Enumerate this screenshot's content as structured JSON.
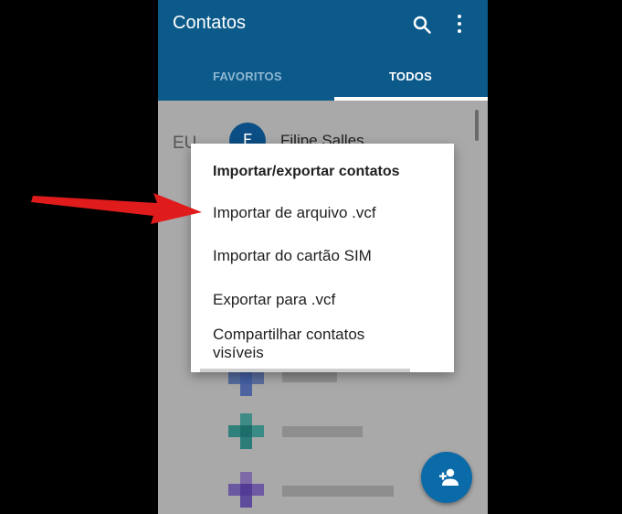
{
  "app": {
    "title": "Contatos"
  },
  "tabs": [
    {
      "label": "FAVORITOS",
      "selected": false
    },
    {
      "label": "TODOS",
      "selected": true
    }
  ],
  "list": {
    "section_label": "EU",
    "contact_initial": "F",
    "contact_name": "Filipe Salles"
  },
  "dialog": {
    "title": "Importar/exportar contatos",
    "items": [
      {
        "label": "Importar de arquivo .vcf"
      },
      {
        "label": "Importar do cartão SIM"
      },
      {
        "label": "Exportar para .vcf"
      },
      {
        "label": "Compartilhar contatos visíveis"
      }
    ]
  },
  "colors": {
    "appbar": "#0b5a8a",
    "accent": "#0b6aa8",
    "annotation_arrow": "#e01b1b"
  },
  "icons": [
    "search-icon",
    "more-vert-icon",
    "add-person-icon",
    "red-arrow-annotation"
  ]
}
